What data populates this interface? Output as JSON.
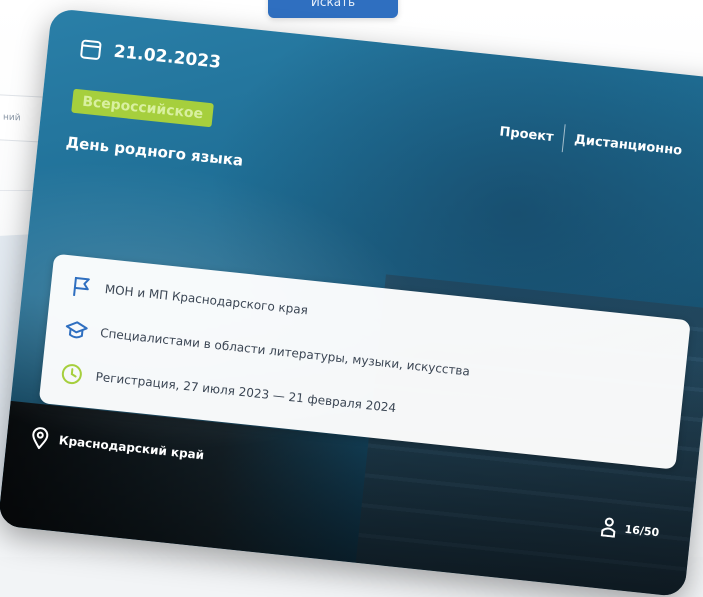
{
  "top_button": {
    "label": "Искать"
  },
  "background": {
    "input_text": "ний"
  },
  "card": {
    "date": "21.02.2023",
    "level_badge": "Всероссийское",
    "title": "День родного языка",
    "tags": [
      "Проект",
      "Дистанционно"
    ],
    "organizer": "МОН и МП Краснодарского края",
    "audience": "Специалистами в области литературы, музыки, искусства",
    "registration": "Регистрация, 27 июля 2023 — 21 февраля 2024",
    "region": "Краснодарский край",
    "participants": "16/50",
    "colors": {
      "badge": "#a6cf3d",
      "organizer_icon": "#2f6fc0",
      "audience_icon": "#2f6fc0",
      "registration_icon": "#a6cf3d"
    },
    "icons": {
      "date": "calendar-icon",
      "organizer": "flag-icon",
      "audience": "graduation-cap-icon",
      "registration": "clock-icon",
      "region": "location-pin-icon",
      "participants": "person-icon"
    }
  }
}
